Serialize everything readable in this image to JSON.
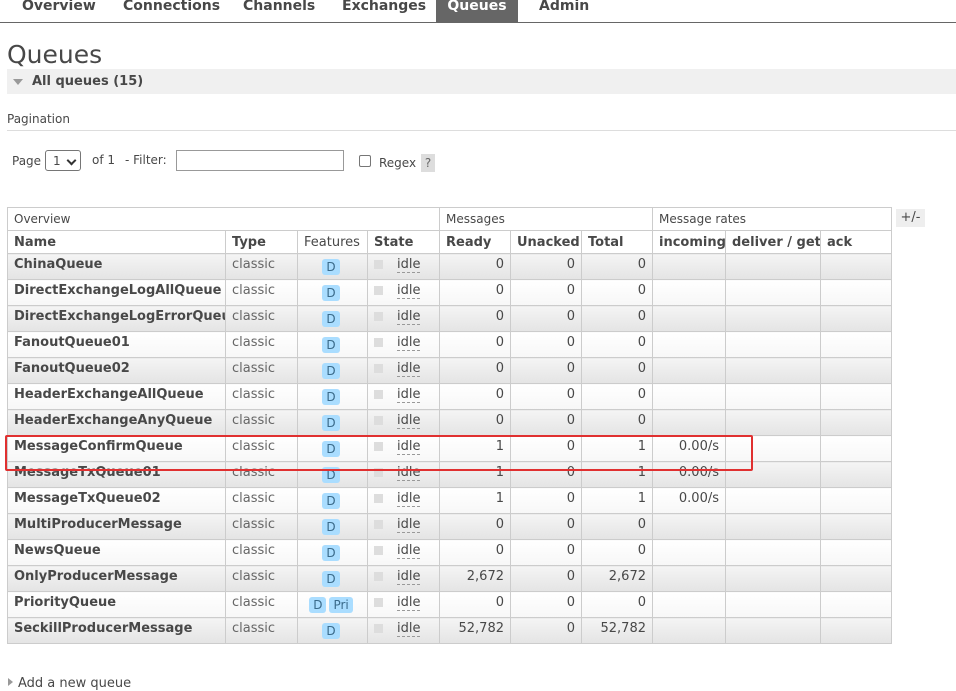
{
  "nav": {
    "tabs": [
      {
        "label": "Overview"
      },
      {
        "label": "Connections"
      },
      {
        "label": "Channels"
      },
      {
        "label": "Exchanges"
      },
      {
        "label": "Queues",
        "active": true
      },
      {
        "label": "Admin"
      }
    ]
  },
  "page": {
    "title": "Queues",
    "section_label": "All queues (15)"
  },
  "pagination": {
    "label": "Pagination",
    "page_label": "Page",
    "page_value": "1",
    "of_label": "of 1",
    "filter_label": "- Filter:",
    "filter_value": "",
    "regex_label": "Regex",
    "regex_checked": false,
    "help_label": "?"
  },
  "table": {
    "toggle_columns_label": "+/-",
    "groups": [
      "Overview",
      "Messages",
      "Message rates"
    ],
    "columns": [
      "Name",
      "Type",
      "Features",
      "State",
      "Ready",
      "Unacked",
      "Total",
      "incoming",
      "deliver / get",
      "ack"
    ],
    "rows": [
      {
        "name": "ChinaQueue",
        "type": "classic",
        "features": [
          "D"
        ],
        "state": "idle",
        "ready": "0",
        "unacked": "0",
        "total": "0",
        "incoming": ""
      },
      {
        "name": "DirectExchangeLogAllQueue",
        "type": "classic",
        "features": [
          "D"
        ],
        "state": "idle",
        "ready": "0",
        "unacked": "0",
        "total": "0",
        "incoming": ""
      },
      {
        "name": "DirectExchangeLogErrorQueue",
        "type": "classic",
        "features": [
          "D"
        ],
        "state": "idle",
        "ready": "0",
        "unacked": "0",
        "total": "0",
        "incoming": ""
      },
      {
        "name": "FanoutQueue01",
        "type": "classic",
        "features": [
          "D"
        ],
        "state": "idle",
        "ready": "0",
        "unacked": "0",
        "total": "0",
        "incoming": ""
      },
      {
        "name": "FanoutQueue02",
        "type": "classic",
        "features": [
          "D"
        ],
        "state": "idle",
        "ready": "0",
        "unacked": "0",
        "total": "0",
        "incoming": ""
      },
      {
        "name": "HeaderExchangeAllQueue",
        "type": "classic",
        "features": [
          "D"
        ],
        "state": "idle",
        "ready": "0",
        "unacked": "0",
        "total": "0",
        "incoming": ""
      },
      {
        "name": "HeaderExchangeAnyQueue",
        "type": "classic",
        "features": [
          "D"
        ],
        "state": "idle",
        "ready": "0",
        "unacked": "0",
        "total": "0",
        "incoming": ""
      },
      {
        "name": "MessageConfirmQueue",
        "type": "classic",
        "features": [
          "D"
        ],
        "state": "idle",
        "ready": "1",
        "unacked": "0",
        "total": "1",
        "incoming": "0.00/s"
      },
      {
        "name": "MessageTxQueue01",
        "type": "classic",
        "features": [
          "D"
        ],
        "state": "idle",
        "ready": "1",
        "unacked": "0",
        "total": "1",
        "incoming": "0.00/s"
      },
      {
        "name": "MessageTxQueue02",
        "type": "classic",
        "features": [
          "D"
        ],
        "state": "idle",
        "ready": "1",
        "unacked": "0",
        "total": "1",
        "incoming": "0.00/s"
      },
      {
        "name": "MultiProducerMessage",
        "type": "classic",
        "features": [
          "D"
        ],
        "state": "idle",
        "ready": "0",
        "unacked": "0",
        "total": "0",
        "incoming": ""
      },
      {
        "name": "NewsQueue",
        "type": "classic",
        "features": [
          "D"
        ],
        "state": "idle",
        "ready": "0",
        "unacked": "0",
        "total": "0",
        "incoming": ""
      },
      {
        "name": "OnlyProducerMessage",
        "type": "classic",
        "features": [
          "D"
        ],
        "state": "idle",
        "ready": "2,672",
        "unacked": "0",
        "total": "2,672",
        "incoming": ""
      },
      {
        "name": "PriorityQueue",
        "type": "classic",
        "features": [
          "D",
          "Pri"
        ],
        "state": "idle",
        "ready": "0",
        "unacked": "0",
        "total": "0",
        "incoming": ""
      },
      {
        "name": "SeckillProducerMessage",
        "type": "classic",
        "features": [
          "D"
        ],
        "state": "idle",
        "ready": "52,782",
        "unacked": "0",
        "total": "52,782",
        "incoming": ""
      }
    ]
  },
  "add_section_label": "Add a new queue",
  "colors": {
    "nav_active_bg": "#666666",
    "badge_bg": "#aaddff",
    "highlight": "#e03030"
  }
}
